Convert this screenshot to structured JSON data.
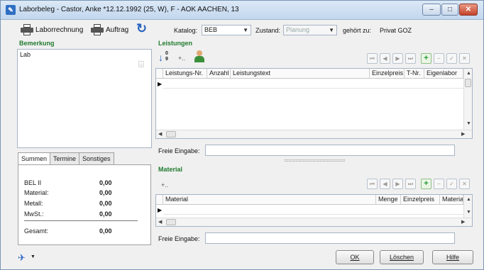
{
  "window": {
    "title": "Laborbeleg - Castor, Anke  *12.12.1992 (25, W), F - AOK AACHEN, 13",
    "min_icon": "minimize-icon",
    "max_icon": "maximize-icon",
    "close_icon": "close-icon"
  },
  "toolbar": {
    "laborrechnung_label": "Laborrechnung",
    "auftrag_label": "Auftrag",
    "katalog_label": "Katalog:",
    "katalog_value": "BEB",
    "zustand_label": "Zustand:",
    "zustand_value": "Planung",
    "gehoert_label": "gehört zu:",
    "gehoert_value": "Privat GOZ"
  },
  "bemerkung": {
    "title": "Bemerkung",
    "text": "Lab"
  },
  "leistungen": {
    "title": "Leistungen",
    "add_icon_text": "+..",
    "columns": [
      "Leistungs-Nr.",
      "Anzahl",
      "Leistungstext",
      "Einzelpreis",
      "T-Nr.",
      "Eigenlabor"
    ],
    "freie_eingabe_label": "Freie Eingabe:"
  },
  "material": {
    "title": "Material",
    "add_icon_text": "+..",
    "columns": [
      "Material",
      "Menge",
      "Einzelpreis",
      "Material"
    ],
    "freie_eingabe_label": "Freie Eingabe:"
  },
  "tabs": [
    "Summen",
    "Termine",
    "Sonstiges"
  ],
  "summen": {
    "rows": [
      {
        "label": "BEL II",
        "value": "0,00"
      },
      {
        "label": "Material:",
        "value": "0,00"
      },
      {
        "label": "Metall:",
        "value": "0,00"
      },
      {
        "label": "MwSt.:",
        "value": "0,00"
      }
    ],
    "gesamt_label": "Gesamt:",
    "gesamt_value": "0,00"
  },
  "buttons": {
    "ok": "OK",
    "loeschen": "Löschen",
    "hilfe": "Hilfe"
  },
  "colors": {
    "section_title": "#1f7a2e",
    "accent_blue": "#2a64c0"
  }
}
